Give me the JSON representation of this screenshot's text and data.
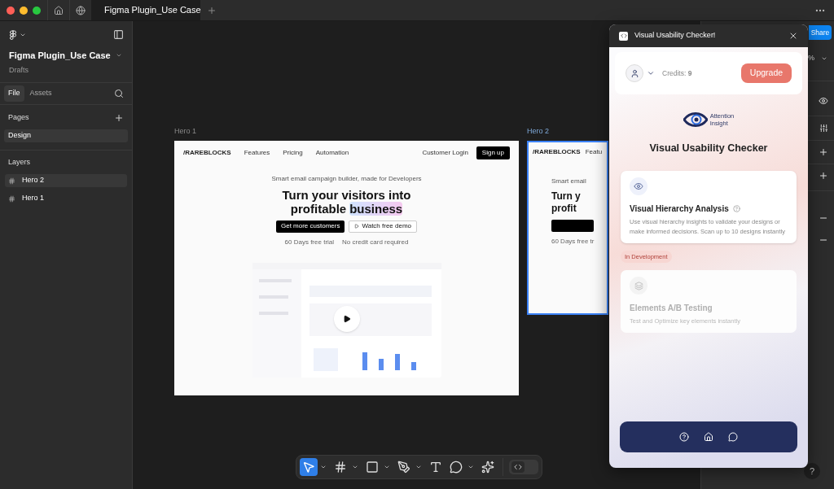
{
  "tab_bar": {
    "tab": "Figma Plugin_Use Case"
  },
  "sidebar": {
    "file_name": "Figma Plugin_Use Case",
    "location": "Drafts",
    "tabs": [
      {
        "label": "File",
        "selected": true
      },
      {
        "label": "Assets",
        "selected": false
      }
    ],
    "pages_heading": "Pages",
    "pages": [
      {
        "label": "Design",
        "selected": true
      }
    ],
    "layers_heading": "Layers",
    "layers": [
      {
        "label": "Hero 2",
        "selected": true
      },
      {
        "label": "Hero 1",
        "selected": false
      }
    ]
  },
  "hero_1": {
    "label": "Hero 1",
    "selected": false,
    "logo": "/RAREBLOCKS",
    "nav": [
      "Features",
      "Pricing",
      "Automation"
    ],
    "login": "Customer Login",
    "signup": "Sign up",
    "tagline": "Smart email campaign builder, made for Developers",
    "headline_line_1": "Turn your visitors into",
    "headline_line_2": "profitable",
    "headline_highlight": "business",
    "primary": "Get more customers",
    "secondary": "Watch free demo",
    "notes": [
      "60 Days free trial",
      "No credit card required"
    ],
    "video": {
      "kind": "picture"
    }
  },
  "hero_2": {
    "label": "Hero 2",
    "selected": true,
    "logo": "/RAREBLOCKS",
    "nav": [
      "Featu"
    ],
    "tagline": "Smart email",
    "headline_line_1": "Turn y",
    "headline_line_2": "profit",
    "notes": [
      "60 Days free tr"
    ]
  },
  "right_panel": {
    "share": "Share",
    "zoom": "%"
  },
  "plugin": {
    "title": "Visual Usability Checker!",
    "credits": "Credits: **9**",
    "upgrade": "Upgrade",
    "brand": [
      "Attention",
      "Insight"
    ],
    "heading": "Visual Usability Checker",
    "features": [
      {
        "kind": "eye",
        "title": "Visual Hierarchy Analysis",
        "help": true,
        "description": "Use visual hierarchy insights to validate your designs or make informed decisions. Scan up to 10 designs instantly",
        "disabled": false
      },
      {
        "kind": "layers",
        "badge": "In Development",
        "title": "Elements A/B Testing",
        "help": false,
        "description": "Test and Optimize key elements instantly",
        "disabled": true
      }
    ]
  },
  "toolbar": {
    "tools": [
      {
        "kind": "move",
        "selected": true,
        "menu": true
      },
      {
        "kind": "frame",
        "selected": false,
        "menu": true
      },
      {
        "kind": "shape",
        "selected": false,
        "menu": true
      },
      {
        "kind": "pen",
        "selected": false,
        "menu": true
      },
      {
        "kind": "text",
        "selected": false,
        "menu": false
      },
      {
        "kind": "comment",
        "selected": false,
        "menu": true
      },
      {
        "kind": "ai",
        "selected": false,
        "menu": false
      }
    ],
    "dev_mode": {
      "on": false
    }
  },
  "help_button": "?"
}
